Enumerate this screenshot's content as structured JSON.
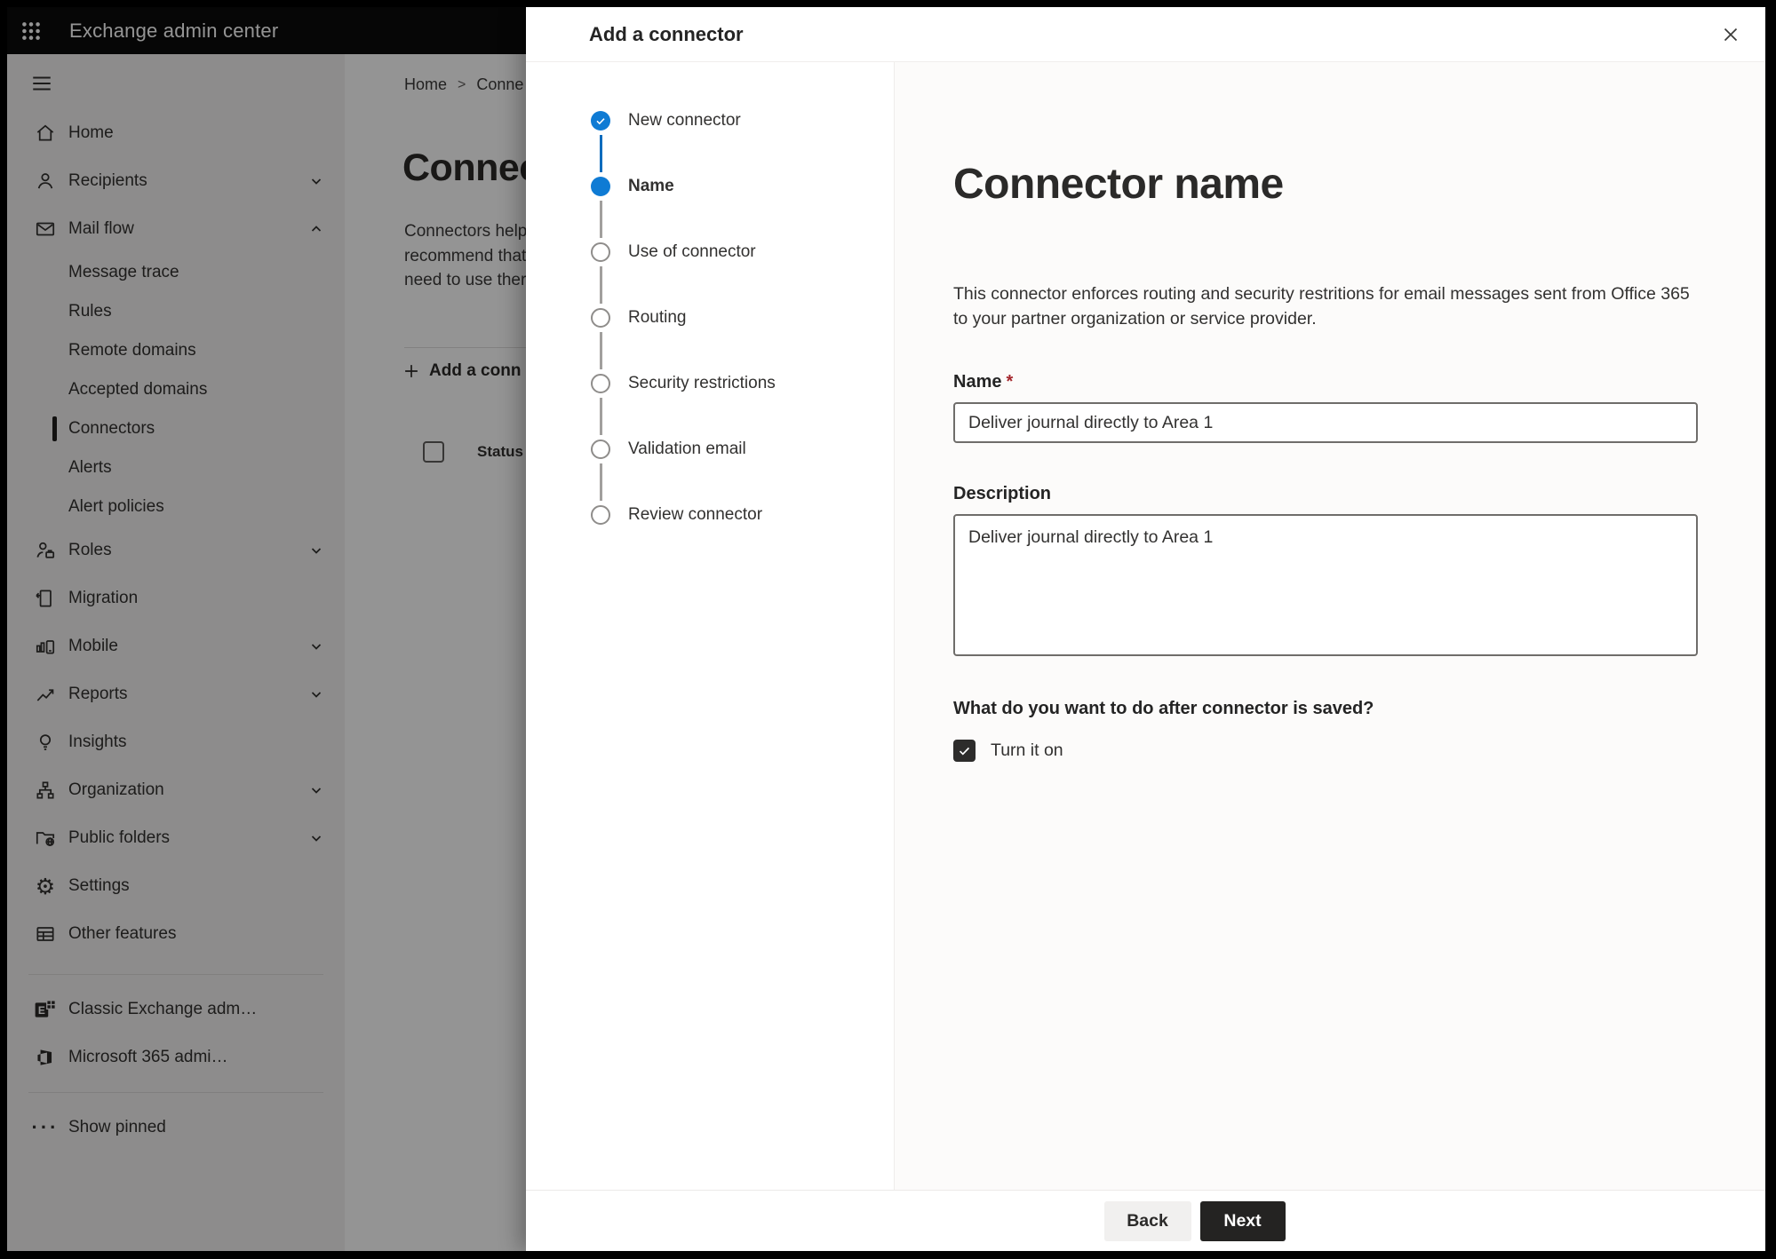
{
  "topbar": {
    "title": "Exchange admin center"
  },
  "sidebar": {
    "items": {
      "home": "Home",
      "recipients": "Recipients",
      "mail_flow": "Mail flow",
      "message_trace": "Message trace",
      "rules": "Rules",
      "remote_domains": "Remote domains",
      "accepted_domains": "Accepted domains",
      "connectors": "Connectors",
      "alerts": "Alerts",
      "alert_policies": "Alert policies",
      "roles": "Roles",
      "migration": "Migration",
      "mobile": "Mobile",
      "reports": "Reports",
      "insights": "Insights",
      "organization": "Organization",
      "public_folders": "Public folders",
      "settings": "Settings",
      "other_features": "Other features",
      "classic_exchange": "Classic Exchange adm…",
      "m365_admin": "Microsoft 365 admi…",
      "show_pinned": "Show pinned"
    }
  },
  "page": {
    "breadcrumb_home": "Home",
    "breadcrumb_sep": ">",
    "breadcrumb_current": "Conne",
    "title": "Connect",
    "body_line1": "Connectors help",
    "body_line2": "recommend that",
    "body_line3": "need to use ther",
    "add_button": "Add a conn",
    "status_header": "Status"
  },
  "dialog": {
    "title": "Add a connector",
    "steps": [
      {
        "label": "New connector",
        "state": "complete"
      },
      {
        "label": "Name",
        "state": "current"
      },
      {
        "label": "Use of connector",
        "state": "upcoming"
      },
      {
        "label": "Routing",
        "state": "upcoming"
      },
      {
        "label": "Security restrictions",
        "state": "upcoming"
      },
      {
        "label": "Validation email",
        "state": "upcoming"
      },
      {
        "label": "Review connector",
        "state": "upcoming"
      }
    ],
    "heading": "Connector name",
    "intro_line1": "This connector enforces routing and security restritions for email messages sent from Office 365",
    "intro_line2": "to your partner organization or service provider.",
    "name_label": "Name",
    "required_mark": "*",
    "name_value": "Deliver journal directly to Area 1",
    "description_label": "Description",
    "description_value": "Deliver journal directly to Area 1",
    "after_save_question": "What do you want to do after connector is saved?",
    "turn_on_label": "Turn it on",
    "back_label": "Back",
    "next_label": "Next"
  },
  "colors": {
    "accent": "#0f7bd4",
    "topbar_bg": "#0b0b0b",
    "sidebar_bg": "#f3f2f1",
    "overlay": "rgba(0,0,0,0.42)",
    "next_button_bg": "#242322",
    "required_red": "#a4262c"
  }
}
